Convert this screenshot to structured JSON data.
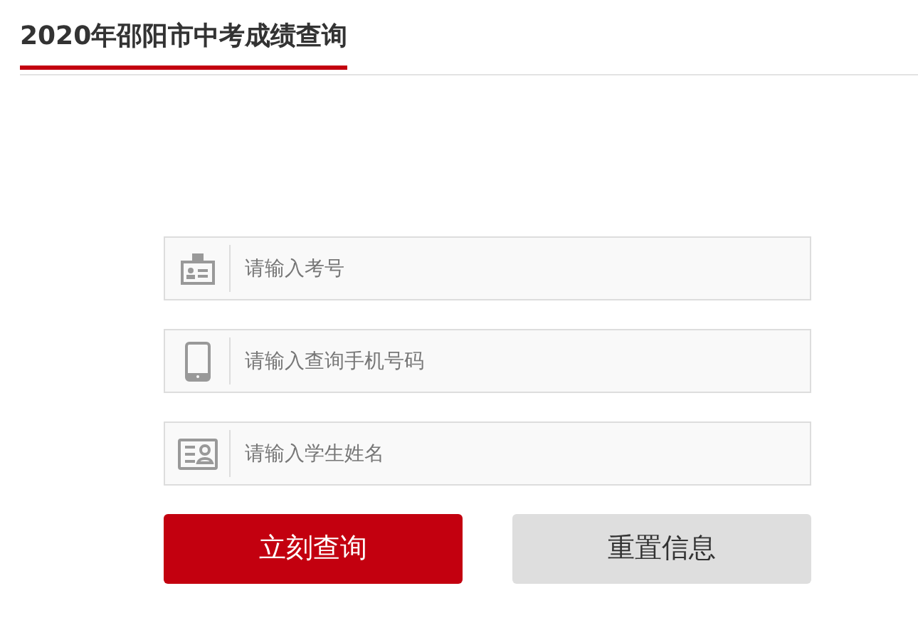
{
  "header": {
    "title": "2020年邵阳市中考成绩查询"
  },
  "fields": [
    {
      "kind": "badge",
      "placeholder": "请输入考号"
    },
    {
      "kind": "phone",
      "placeholder": "请输入查询手机号码"
    },
    {
      "kind": "idcard",
      "placeholder": "请输入学生姓名"
    }
  ],
  "buttons": [
    {
      "kind": "primary",
      "label": "立刻查询"
    },
    {
      "kind": "secondary",
      "label": "重置信息"
    }
  ]
}
